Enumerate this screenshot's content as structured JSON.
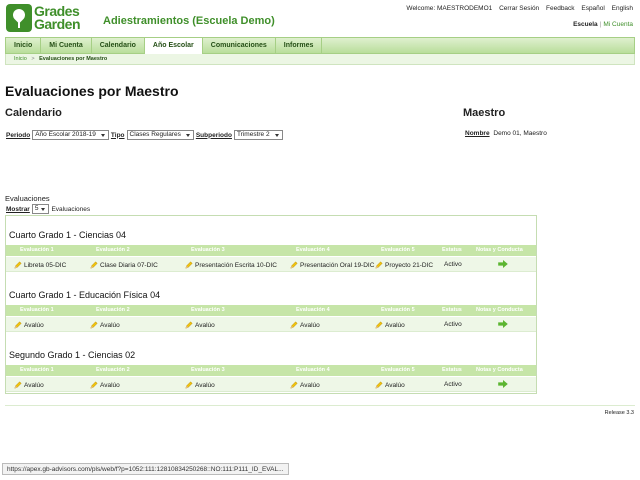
{
  "header": {
    "logo_line1": "Grades",
    "logo_line2": "Garden",
    "app_title": "Adiestramientos (Escuela Demo)",
    "top_links": [
      "Welcome: MAESTRODEMO1",
      "Cerrar Sesión",
      "Feedback",
      "Español",
      "English"
    ],
    "sub_links": {
      "active": "Escuela",
      "sep": "|",
      "other": "Mi Cuenta"
    }
  },
  "nav": {
    "items": [
      {
        "label": "Inicio",
        "active": false
      },
      {
        "label": "Mi Cuenta",
        "active": false
      },
      {
        "label": "Calendario",
        "active": false
      },
      {
        "label": "Año Escolar",
        "active": true
      },
      {
        "label": "Comunicaciones",
        "active": false
      },
      {
        "label": "Informes",
        "active": false
      }
    ]
  },
  "breadcrumb": {
    "home": "Inicio",
    "sep": ">",
    "current": "Evaluaciones por Maestro"
  },
  "page_title": "Evaluaciones por Maestro",
  "calendar": {
    "title": "Calendario",
    "periodo_label": "Periodo",
    "periodo_value": "Año Escolar 2018-19",
    "tipo_label": "Tipo",
    "tipo_value": "Clases Regulares",
    "subperiodo_label": "Subperiodo",
    "subperiodo_value": "Trimestre 2"
  },
  "teacher": {
    "title": "Maestro",
    "nombre_label": "Nombre",
    "nombre_value": "Demo 01, Maestro"
  },
  "evaluations": {
    "title": "Evaluaciones",
    "mostrar_label": "Mostrar",
    "mostrar_value": "5",
    "mostrar_suffix": "Evaluaciones",
    "columns": [
      "Evaluación 1",
      "Evaluación 2",
      "Evaluación 3",
      "Evaluación 4",
      "Evaluación 5",
      "Estatus",
      "Notas y Conducta"
    ],
    "groups": [
      {
        "title": "Cuarto Grado 1 - Ciencias 04",
        "cells": [
          "Libreta 05-DIC",
          "Clase Diaria 07-DIC",
          "Presentación Escrita 10-DIC",
          "Presentación Oral 19-DIC",
          "Proyecto 21-DIC"
        ],
        "status": "Activo"
      },
      {
        "title": "Cuarto Grado 1 - Educación Física 04",
        "cells": [
          "Avalúo",
          "Avalúo",
          "Avalúo",
          "Avalúo",
          "Avalúo"
        ],
        "status": "Activo"
      },
      {
        "title": "Segundo Grado 1 - Ciencias 02",
        "cells": [
          "Avalúo",
          "Avalúo",
          "Avalúo",
          "Avalúo",
          "Avalúo"
        ],
        "status": "Activo"
      }
    ]
  },
  "release": "Release 3.3",
  "status_url": "https://apex.gb-advisors.com/pls/web/f?p=1052:111:12810834250268::NO:111:P111_ID_EVAL...",
  "colors": {
    "brand": "#3f8f2a",
    "header_band": "#c6e5a8",
    "row_bg": "#eef7e7"
  }
}
